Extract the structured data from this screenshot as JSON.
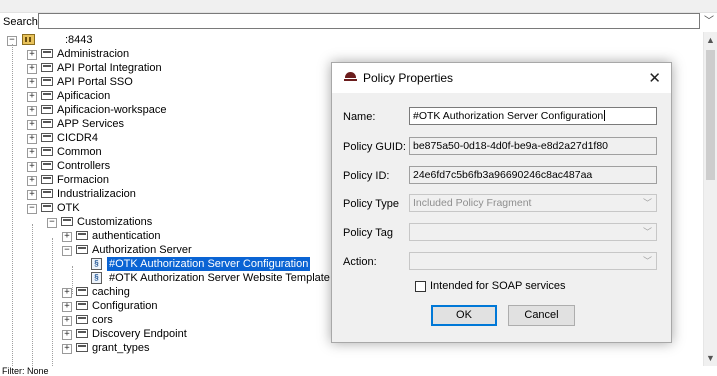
{
  "search": {
    "label": "Search",
    "value": ""
  },
  "tree": {
    "root": ":8443",
    "items": [
      "Administracion",
      "API Portal Integration",
      "API Portal SSO",
      "Apificacion",
      "Apificacion-workspace",
      "APP Services",
      "CICDR4",
      "Common",
      "Controllers",
      "Formacion",
      "Industrializacion",
      "OTK"
    ],
    "otk_children": {
      "customizations": "Customizations",
      "customizations_children": [
        "authentication",
        "Authorization Server"
      ],
      "auth_server_policies": [
        "#OTK Authorization Server Configuration",
        "#OTK Authorization Server Website Template"
      ],
      "more": [
        "caching",
        "Configuration",
        "cors",
        "Discovery Endpoint",
        "grant_types"
      ]
    }
  },
  "status": {
    "filter": "Filter: None"
  },
  "dialog": {
    "title": "Policy Properties",
    "close_glyph": "✕",
    "fields": {
      "name": {
        "label": "Name:",
        "value": "#OTK Authorization Server Configuration"
      },
      "guid": {
        "label": "Policy GUID:",
        "value": "be875a50-0d18-4d0f-be9a-e8d2a27d1f80"
      },
      "id": {
        "label": "Policy ID:",
        "value": "24e6fd7c5b6fb3a96690246c8ac487aa"
      },
      "type": {
        "label": "Policy Type",
        "value": "Included Policy Fragment"
      },
      "tag": {
        "label": "Policy Tag",
        "value": ""
      },
      "action": {
        "label": "Action:",
        "value": ""
      }
    },
    "soap_checkbox": {
      "label": "Intended for SOAP services",
      "checked": false
    },
    "ok_label": "OK",
    "cancel_label": "Cancel"
  },
  "icons": {
    "expand_plus": "+",
    "expand_minus": "−",
    "combo_arrow": "﹀",
    "scroll_up": "▲",
    "scroll_down": "▼",
    "search_drop": "﹀"
  },
  "colors": {
    "selection": "#0a64d4",
    "default_button_border": "#0078d7"
  }
}
